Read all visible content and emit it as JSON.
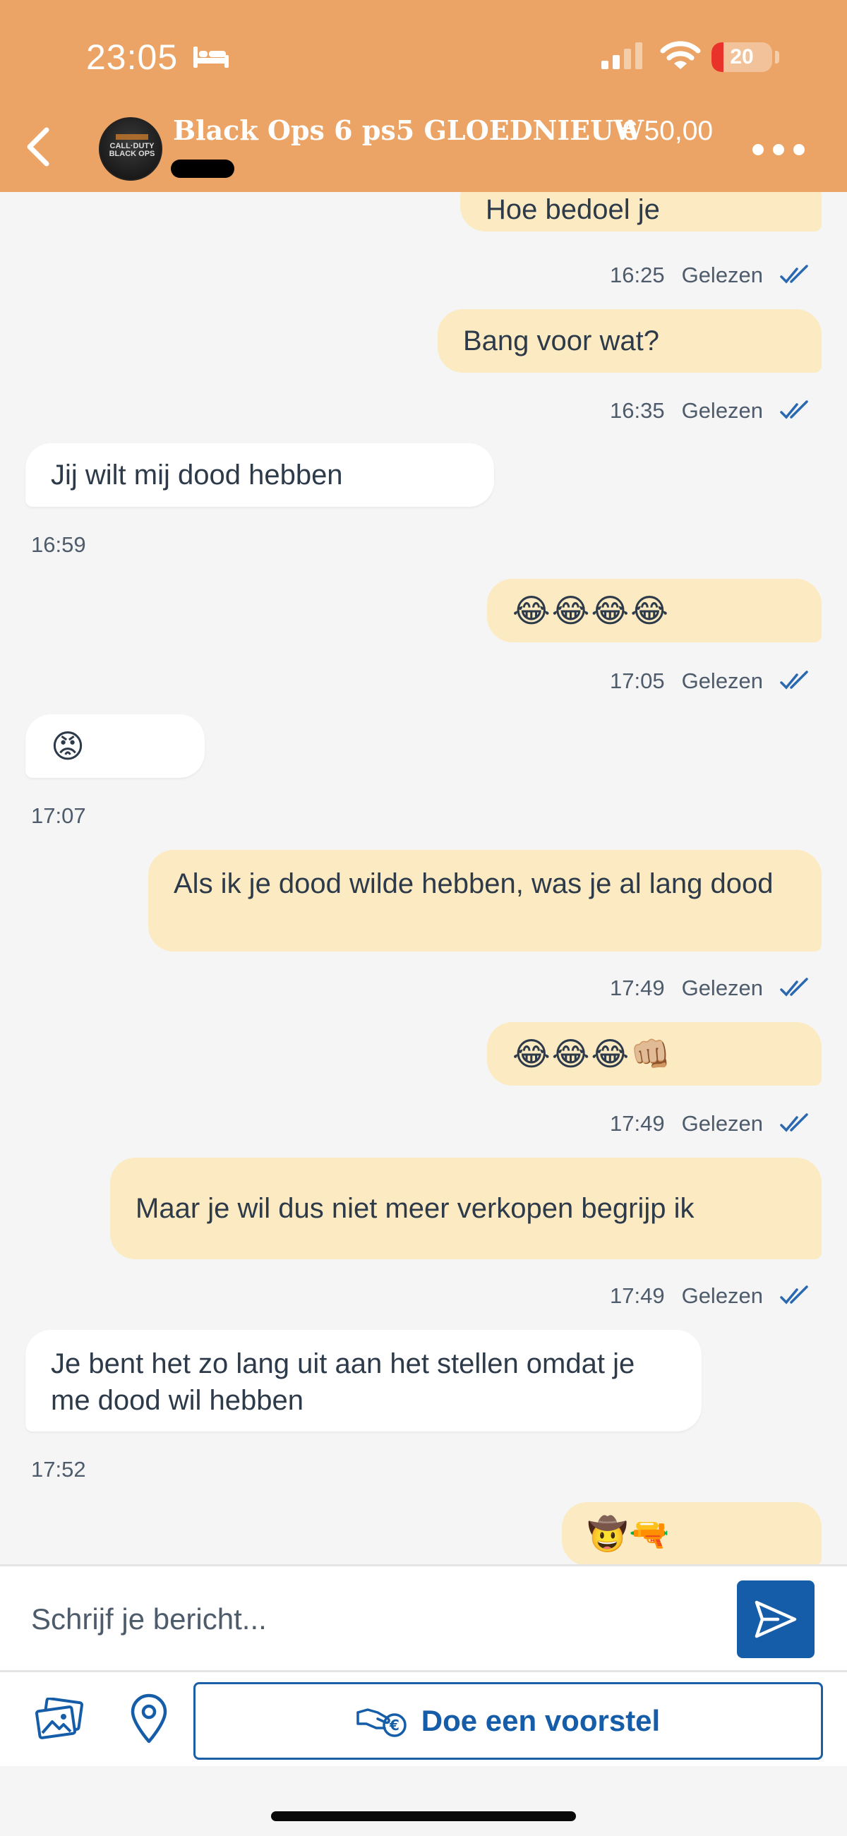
{
  "status_bar": {
    "time": "23:05",
    "battery": "20",
    "battery_level_percent": 20
  },
  "header": {
    "title": "Black Ops 6 ps5 GLOEDNIEUW",
    "price": "€ 50,00",
    "avatar_text": "CALL·DUTY BLACK OPS",
    "icons": {
      "back": "chevron-left-icon",
      "more": "ellipsis-icon"
    }
  },
  "messages": [
    {
      "side": "me",
      "text": "Hoe bedoel je",
      "time": "16:25",
      "status": "Gelezen"
    },
    {
      "side": "me",
      "text": "Bang voor wat?",
      "time": "16:35",
      "status": "Gelezen"
    },
    {
      "side": "them",
      "text": "Jij wilt mij dood hebben",
      "time": "16:59"
    },
    {
      "side": "me",
      "text": "😂😂😂😂",
      "time": "17:05",
      "status": "Gelezen"
    },
    {
      "side": "them",
      "text": "😡",
      "time": "17:07"
    },
    {
      "side": "me",
      "text": "Als ik je dood wilde hebben, was je al lang dood",
      "time": "17:49",
      "status": "Gelezen"
    },
    {
      "side": "me",
      "text": "😂😂😂👊🏼",
      "time": "17:49",
      "status": "Gelezen"
    },
    {
      "side": "me",
      "text": "Maar je wil dus niet meer verkopen begrijp ik",
      "time": "17:49",
      "status": "Gelezen"
    },
    {
      "side": "them",
      "text": "Je bent het zo lang uit aan het stellen omdat je me dood wil hebben",
      "time": "17:52"
    },
    {
      "side": "me",
      "text": "🤠🔫"
    }
  ],
  "composer": {
    "placeholder": "Schrijf je bericht...",
    "send_icon": "send-icon"
  },
  "actions": {
    "photo_icon": "photos-icon",
    "location_icon": "location-pin-icon",
    "offer_label": "Doe een voorstel",
    "offer_icon": "hand-money-icon"
  },
  "colors": {
    "header": "#eba465",
    "my_bubble": "#fcebc2",
    "their_bubble": "#ffffff",
    "accent": "#155da8"
  }
}
